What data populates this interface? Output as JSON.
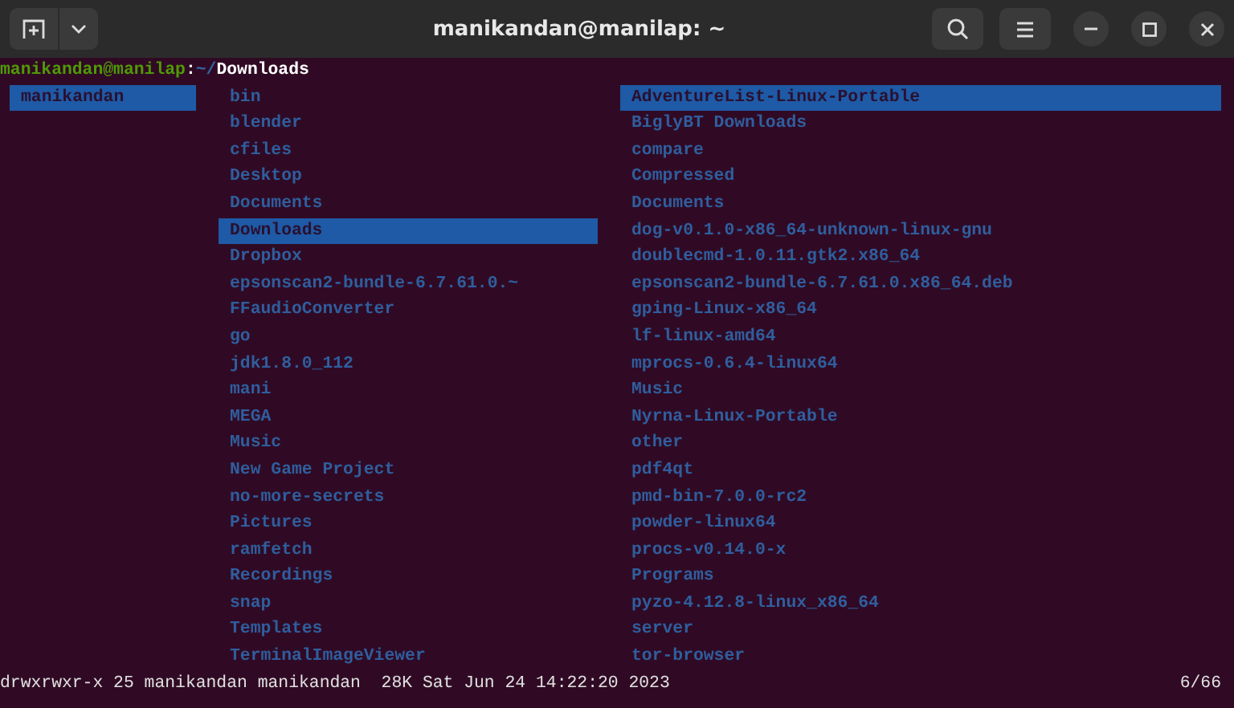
{
  "window": {
    "title": "manikandan@manilap: ~"
  },
  "prompt": [
    {
      "kind": "user",
      "text": "manikandan@manilap"
    },
    {
      "kind": "sep",
      "text": ":"
    },
    {
      "kind": "home",
      "text": "~/"
    },
    {
      "kind": "dir",
      "text": "Downloads"
    }
  ],
  "parent_column": [
    {
      "name": "manikandan",
      "selected": true
    }
  ],
  "current_column": [
    {
      "name": "bin",
      "selected": false
    },
    {
      "name": "blender",
      "selected": false
    },
    {
      "name": "cfiles",
      "selected": false
    },
    {
      "name": "Desktop",
      "selected": false
    },
    {
      "name": "Documents",
      "selected": false
    },
    {
      "name": "Downloads",
      "selected": true
    },
    {
      "name": "Dropbox",
      "selected": false
    },
    {
      "name": "epsonscan2-bundle-6.7.61.0.~",
      "selected": false
    },
    {
      "name": "FFaudioConverter",
      "selected": false
    },
    {
      "name": "go",
      "selected": false
    },
    {
      "name": "jdk1.8.0_112",
      "selected": false
    },
    {
      "name": "mani",
      "selected": false
    },
    {
      "name": "MEGA",
      "selected": false
    },
    {
      "name": "Music",
      "selected": false
    },
    {
      "name": "New Game Project",
      "selected": false
    },
    {
      "name": "no-more-secrets",
      "selected": false
    },
    {
      "name": "Pictures",
      "selected": false
    },
    {
      "name": "ramfetch",
      "selected": false
    },
    {
      "name": "Recordings",
      "selected": false
    },
    {
      "name": "snap",
      "selected": false
    },
    {
      "name": "Templates",
      "selected": false
    },
    {
      "name": "TerminalImageViewer",
      "selected": false
    }
  ],
  "preview_column": [
    {
      "name": "AdventureList-Linux-Portable",
      "selected": true
    },
    {
      "name": "BiglyBT Downloads",
      "selected": false
    },
    {
      "name": "compare",
      "selected": false
    },
    {
      "name": "Compressed",
      "selected": false
    },
    {
      "name": "Documents",
      "selected": false
    },
    {
      "name": "dog-v0.1.0-x86_64-unknown-linux-gnu",
      "selected": false
    },
    {
      "name": "doublecmd-1.0.11.gtk2.x86_64",
      "selected": false
    },
    {
      "name": "epsonscan2-bundle-6.7.61.0.x86_64.deb",
      "selected": false
    },
    {
      "name": "gping-Linux-x86_64",
      "selected": false
    },
    {
      "name": "lf-linux-amd64",
      "selected": false
    },
    {
      "name": "mprocs-0.6.4-linux64",
      "selected": false
    },
    {
      "name": "Music",
      "selected": false
    },
    {
      "name": "Nyrna-Linux-Portable",
      "selected": false
    },
    {
      "name": "other",
      "selected": false
    },
    {
      "name": "pdf4qt",
      "selected": false
    },
    {
      "name": "pmd-bin-7.0.0-rc2",
      "selected": false
    },
    {
      "name": "powder-linux64",
      "selected": false
    },
    {
      "name": "procs-v0.14.0-x",
      "selected": false
    },
    {
      "name": "Programs",
      "selected": false
    },
    {
      "name": "pyzo-4.12.8-linux_x86_64",
      "selected": false
    },
    {
      "name": "server",
      "selected": false
    },
    {
      "name": "tor-browser",
      "selected": false
    }
  ],
  "status_bar": {
    "info": "drwxrwxr-x 25 manikandan manikandan  28K Sat Jun 24 14:22:20 2023",
    "position": "6/66"
  }
}
